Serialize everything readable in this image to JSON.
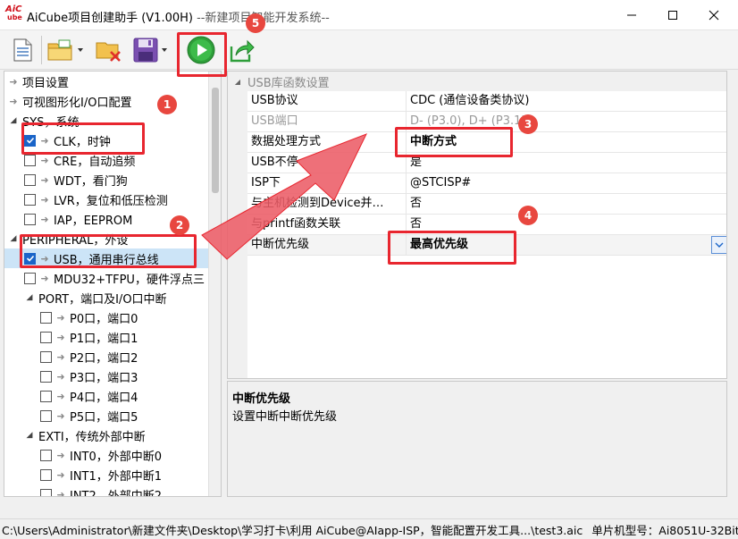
{
  "titlebar": {
    "app_logo": "AiCube",
    "title": "AiCube项目创建助手 (V1.00H)",
    "title_tail": " --新建项目智能开发系统--"
  },
  "toolbar": {
    "buttons": [
      "new-file-icon",
      "open-folder-icon",
      "close-project-icon",
      "save-icon",
      "run-icon",
      "export-icon"
    ]
  },
  "tree": {
    "items": [
      {
        "label": "项目设置",
        "type": "leaf"
      },
      {
        "label": "可视图形化I/O口配置",
        "type": "leaf"
      },
      {
        "label": "SYS，系统",
        "type": "group"
      },
      {
        "label": "CLK，时钟",
        "type": "check",
        "checked": true
      },
      {
        "label": "CRE，自动追频",
        "type": "check",
        "checked": false
      },
      {
        "label": "WDT，看门狗",
        "type": "check",
        "checked": false
      },
      {
        "label": "LVR，复位和低压检测",
        "type": "check",
        "checked": false
      },
      {
        "label": "IAP，EEPROM",
        "type": "check",
        "checked": false
      },
      {
        "label": "PERIPHERAL，外设",
        "type": "group"
      },
      {
        "label": "USB，通用串行总线",
        "type": "check",
        "checked": true,
        "selected": true
      },
      {
        "label": "MDU32+TFPU，硬件浮点三",
        "type": "check",
        "checked": false
      },
      {
        "label": "PORT，端口及I/O口中断",
        "type": "group"
      },
      {
        "label": "P0口，端口0",
        "type": "check",
        "checked": false
      },
      {
        "label": "P1口，端口1",
        "type": "check",
        "checked": false
      },
      {
        "label": "P2口，端口2",
        "type": "check",
        "checked": false
      },
      {
        "label": "P3口，端口3",
        "type": "check",
        "checked": false
      },
      {
        "label": "P4口，端口4",
        "type": "check",
        "checked": false
      },
      {
        "label": "P5口，端口5",
        "type": "check",
        "checked": false
      },
      {
        "label": "EXTI，传统外部中断",
        "type": "group"
      },
      {
        "label": "INT0，外部中断0",
        "type": "check",
        "checked": false
      },
      {
        "label": "INT1，外部中断1",
        "type": "check",
        "checked": false
      },
      {
        "label": "INT2，外部中断2",
        "type": "check",
        "checked": false
      }
    ]
  },
  "grid": {
    "section": "USB库函数设置",
    "rows": [
      {
        "name": "USB协议",
        "value": "CDC (通信设备类协议)",
        "disabled": false,
        "bold": false
      },
      {
        "name": "USB端口",
        "value": "D- (P3.0), D+ (P3.1)",
        "disabled": true,
        "bold": false
      },
      {
        "name": "数据处理方式",
        "value": "中断方式",
        "disabled": false,
        "bold": true
      },
      {
        "name": "USB不停",
        "value": "是",
        "disabled": false,
        "bold": false
      },
      {
        "name": "ISP下",
        "value": "@STCISP#",
        "disabled": false,
        "bold": false
      },
      {
        "name": "与主机检测到Device并…",
        "value": "否",
        "disabled": false,
        "bold": false
      },
      {
        "name": "与printf函数关联",
        "value": "否",
        "disabled": false,
        "bold": false
      },
      {
        "name": "中断优先级",
        "value": "最高优先级",
        "disabled": false,
        "bold": true
      }
    ]
  },
  "description": {
    "title": "中断优先级",
    "text": "设置中断中断优先级"
  },
  "statusbar": {
    "path": "C:\\Users\\Administrator\\新建文件夹\\Desktop\\学习打卡\\利用 AiCube@AIapp-ISP，智能配置开发工具...\\test3.aic",
    "chip": "单片机型号：Ai8051U-32Bit"
  },
  "annotations": {
    "badges": [
      "1",
      "2",
      "3",
      "4",
      "5"
    ],
    "color": "#e8262f"
  }
}
